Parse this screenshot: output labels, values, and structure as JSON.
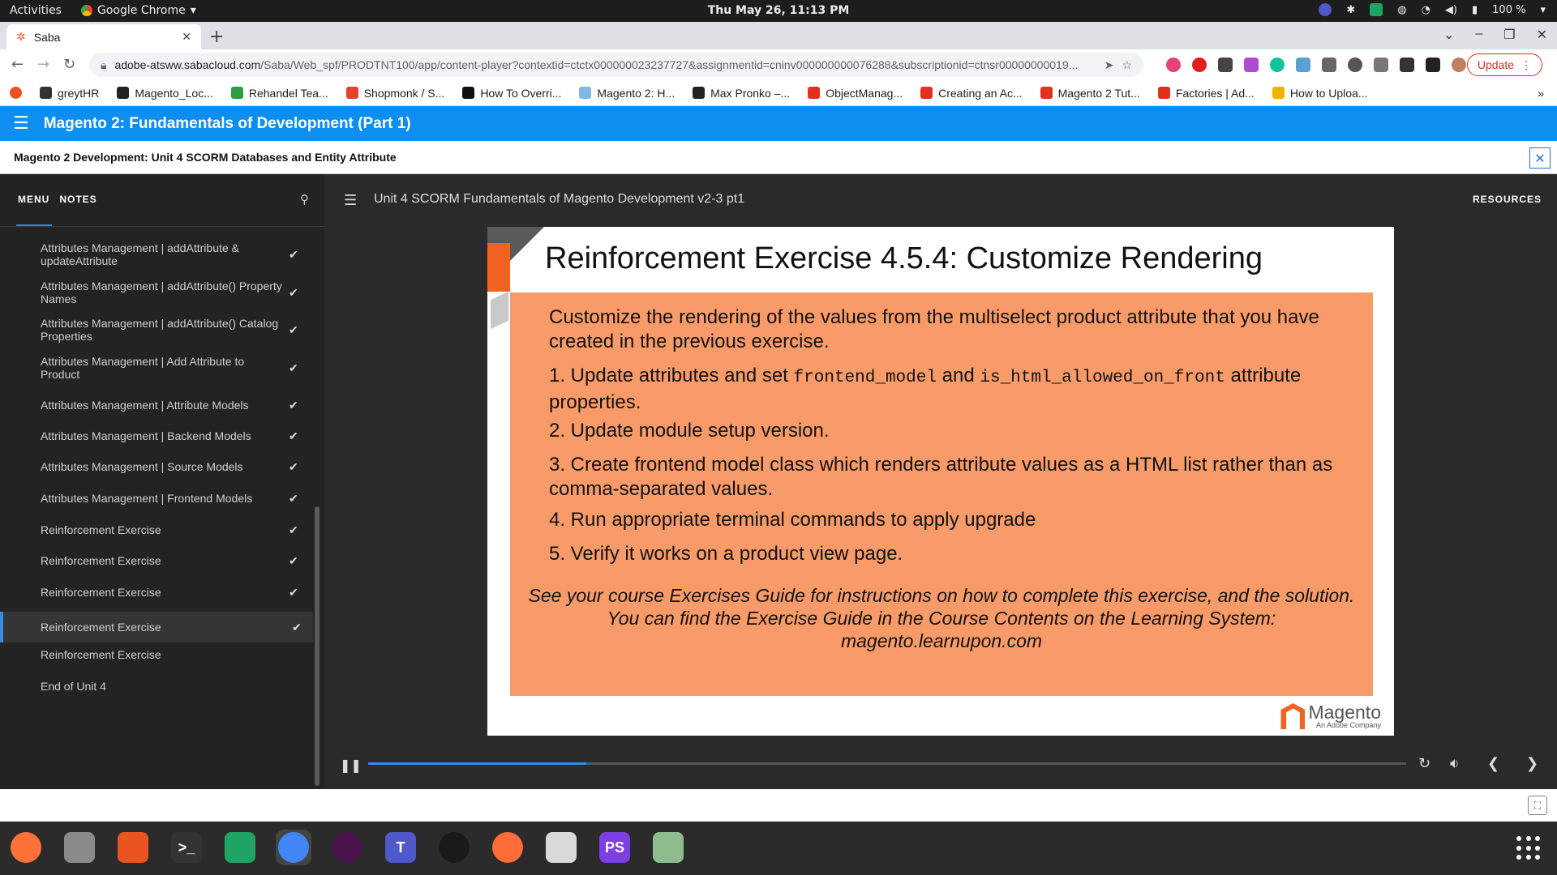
{
  "system": {
    "activities": "Activities",
    "app_name": "Google Chrome",
    "clock": "Thu May 26, 11:13 PM",
    "battery": "100 %"
  },
  "browser": {
    "tab_title": "Saba",
    "url_host": "adobe-atsww.sabacloud.com",
    "url_path": "/Saba/Web_spf/PRODTNT100/app/content-player?contextid=ctctx000000023237727&assignmentid=cninv000000000076288&subscriptionid=ctnsr00000000019...",
    "update_label": "Update",
    "bookmarks": [
      {
        "label": "greytHR",
        "color": "#333333"
      },
      {
        "label": "Magento_Loc...",
        "color": "#222222"
      },
      {
        "label": "Rehandel Tea...",
        "color": "#2e9e44"
      },
      {
        "label": "Shopmonk / S...",
        "color": "#e24329"
      },
      {
        "label": "How To Overri...",
        "color": "#111111"
      },
      {
        "label": "Magento 2: H...",
        "color": "#7fb8e6"
      },
      {
        "label": "Max Pronko –...",
        "color": "#222222"
      },
      {
        "label": "ObjectManag...",
        "color": "#e0301e"
      },
      {
        "label": "Creating an Ac...",
        "color": "#e0301e"
      },
      {
        "label": "Magento 2 Tut...",
        "color": "#e0301e"
      },
      {
        "label": "Factories | Ad...",
        "color": "#e0301e"
      },
      {
        "label": "How to Uploa...",
        "color": "#f0b400"
      }
    ]
  },
  "saba": {
    "course_title": "Magento 2: Fundamentals of Development (Part 1)",
    "unit_title": "Magento 2 Development: Unit 4 SCORM Databases and Entity Attribute",
    "close_symbol": "✕"
  },
  "sidebar": {
    "tab_menu": "MENU",
    "tab_notes": "NOTES",
    "items": [
      {
        "label": "Attributes Management | addAttribute & updateAttribute",
        "check": "✔"
      },
      {
        "label": "Attributes Management | addAttribute() Property Names",
        "check": "✔"
      },
      {
        "label": "Attributes Management | addAttribute() Catalog Properties",
        "check": "✔"
      },
      {
        "label": "Attributes Management | Add Attribute to Product",
        "check": "✔"
      },
      {
        "label": "Attributes Management | Attribute Models",
        "check": "✔"
      },
      {
        "label": "Attributes Management | Backend Models",
        "check": "✔"
      },
      {
        "label": "Attributes Management | Source Models",
        "check": "✔"
      },
      {
        "label": "Attributes Management | Frontend Models",
        "check": "✔"
      },
      {
        "label": "Reinforcement Exercise",
        "check": "✔"
      },
      {
        "label": "Reinforcement Exercise",
        "check": "✔"
      },
      {
        "label": "Reinforcement Exercise",
        "check": "✔"
      },
      {
        "label": "Reinforcement Exercise",
        "check": "✔"
      },
      {
        "label": "Reinforcement Exercise",
        "check": ""
      },
      {
        "label": "End of Unit 4",
        "check": ""
      }
    ]
  },
  "player": {
    "content_title": "Unit 4 SCORM Fundamentals of Magento Development v2-3 pt1",
    "resources_label": "RESOURCES",
    "progress": 0.21
  },
  "slide": {
    "title": "Reinforcement Exercise 4.5.4: Customize Rendering",
    "intro": "Customize the rendering of the values from the multiselect product attribute that you have created in the previous exercise.",
    "step1_a": "1. Update attributes and set ",
    "step1_code1": "frontend_model",
    "step1_b": " and ",
    "step1_code2": "is_html_allowed_on_front",
    "step1_c": " attribute properties.",
    "step2": "2. Update module setup version.",
    "step3": "3. Create frontend model class which renders attribute values as a HTML list rather than as comma-separated values.",
    "step4": "4. Run appropriate terminal commands to apply upgrade",
    "step5": "5. Verify it works on a product view page.",
    "note": "See your course Exercises Guide for instructions on how to complete this exercise, and the solution. You can find the Exercise Guide in the Course Contents on the Learning System: magento.learnupon.com",
    "logo_name": "Magento",
    "logo_sub": "An Adobe Company"
  },
  "dock": [
    {
      "name": "firefox",
      "label": "",
      "color": "#ff7139"
    },
    {
      "name": "files",
      "label": "",
      "color": "#8a8a8a"
    },
    {
      "name": "software",
      "label": "",
      "color": "#e95420"
    },
    {
      "name": "terminal",
      "label": ">_",
      "color": "#333333"
    },
    {
      "name": "chat",
      "label": "",
      "color": "#1fa463"
    },
    {
      "name": "chrome",
      "label": "",
      "color": "#4285f4"
    },
    {
      "name": "slack",
      "label": "",
      "color": "#4a154b"
    },
    {
      "name": "teams",
      "label": "T",
      "color": "#5059c9"
    },
    {
      "name": "camera",
      "label": "",
      "color": "#1a1a1a"
    },
    {
      "name": "postman",
      "label": "",
      "color": "#ff6c37"
    },
    {
      "name": "editor",
      "label": "",
      "color": "#d9d9d9"
    },
    {
      "name": "phpstorm",
      "label": "PS",
      "color": "#7b3fe4"
    },
    {
      "name": "screenshot",
      "label": "",
      "color": "#8fbc8f"
    }
  ]
}
